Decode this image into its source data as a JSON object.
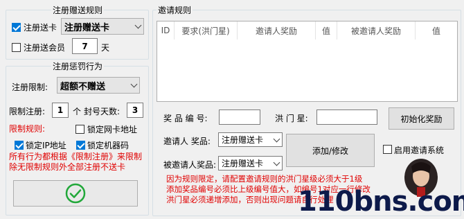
{
  "register_gift": {
    "title": "注册赠送规则",
    "gift_card_label": "注册送卡",
    "gift_card_checked": true,
    "gift_card_value": "注册赠送卡",
    "vip_label": "注册送会员",
    "vip_checked": false,
    "vip_days": "7",
    "vip_unit": "天"
  },
  "penalty": {
    "title": "注册惩罚行为",
    "limit_label": "注册限制:",
    "limit_value": "超额不赠送",
    "limit_reg_label": "限制注册:",
    "limit_reg_value": "1",
    "limit_reg_unit": "个",
    "ban_days_label": "封号天数:",
    "ban_days_value": "3",
    "rules_label": "限制规则:",
    "lock_mac_label": "锁定网卡地址",
    "lock_mac_checked": false,
    "lock_ip_label": "锁定IP地址",
    "lock_ip_checked": true,
    "lock_machine_label": "锁定机器码",
    "lock_machine_checked": true,
    "note": "所有行为都根据《限制注册》来限制除无限制规则外全部注册不送卡"
  },
  "invite": {
    "title": "邀请规则",
    "columns": [
      "ID",
      "要求(洪门星)",
      "邀请人奖励",
      "值",
      "被邀请人奖励",
      "值"
    ],
    "reward_no_label": "奖 品 编 号:",
    "reward_no_value": "",
    "star_label": "洪 门 星:",
    "star_value": "",
    "init_button": "初始化奖励",
    "inviter_label": "邀请人 奖品:",
    "inviter_value": "注册赠送卡",
    "invitee_label": "被邀请人奖品:",
    "invitee_value": "注册赠送卡",
    "add_button": "添加/修改",
    "enable_label": "启用邀请系统",
    "enable_checked": false,
    "notes": [
      "因为规则限定，请配置邀请规则的洪门星级必须大于1级",
      "添加奖品编号必须比上级编号值大，如编号1对应一行修改",
      "洪门星必须递增添加，否则出现问题请自行处理"
    ]
  },
  "watermark": "110bns.com"
}
